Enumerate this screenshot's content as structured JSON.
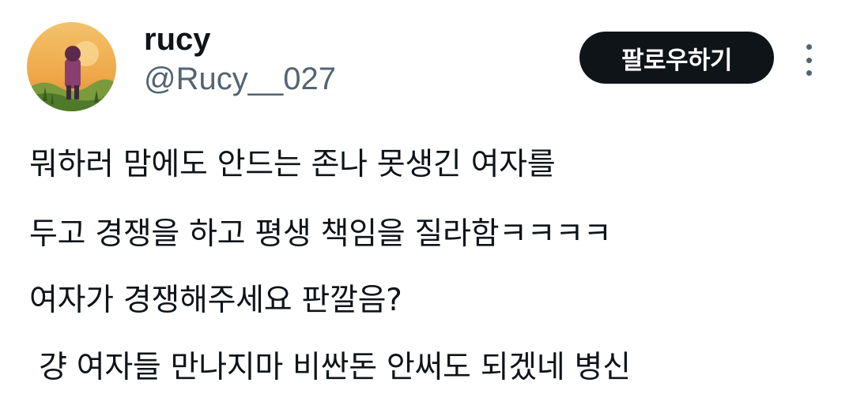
{
  "author": {
    "display_name": "rucy",
    "handle": "@Rucy__027",
    "avatar_icon": "illustrated-avatar"
  },
  "actions": {
    "follow_label": "팔로우하기",
    "more_icon": "more-vertical-icon"
  },
  "tweet": {
    "lines": [
      "뭐하러 맘에도 안드는 존나 못생긴 여자를",
      "두고 경쟁을 하고 평생 책임을 질라함ㅋㅋㅋㅋ",
      "여자가 경쟁해주세요 판깔음?",
      " 걍 여자들 만나지마 비싼돈 안써도 되겠네 병신"
    ]
  },
  "colors": {
    "text_primary": "#0f1419",
    "text_secondary": "#536471",
    "follow_bg": "#0f1419",
    "follow_text": "#ffffff"
  }
}
